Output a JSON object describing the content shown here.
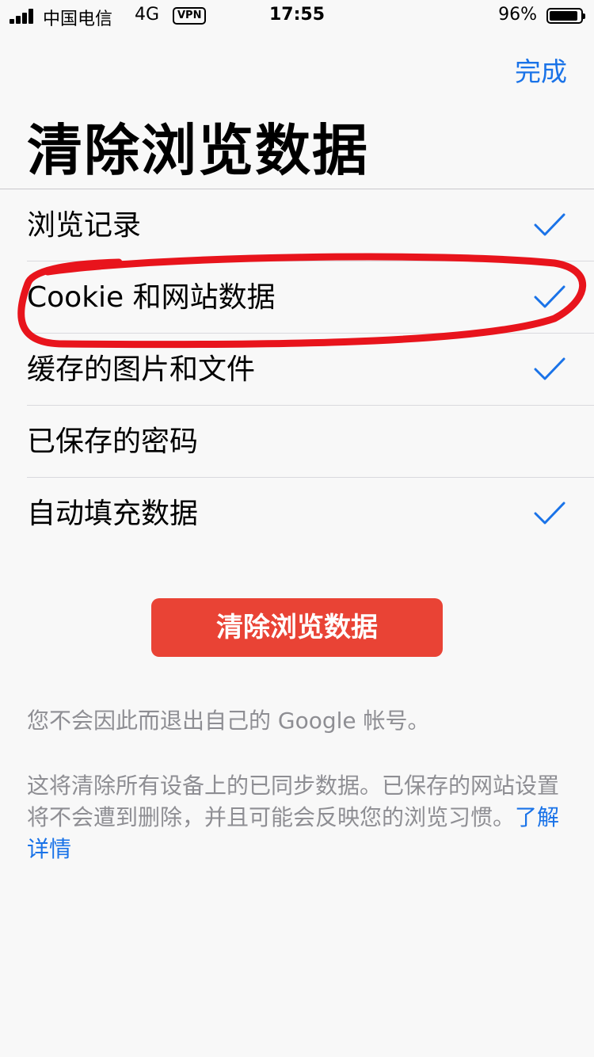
{
  "status_bar": {
    "carrier": "中国电信",
    "network": "4G",
    "vpn": "VPN",
    "time": "17:55",
    "battery": "96%"
  },
  "header": {
    "done_label": "完成",
    "title": "清除浏览数据"
  },
  "options": [
    {
      "label": "浏览记录",
      "checked": true
    },
    {
      "label": "Cookie 和网站数据",
      "checked": true
    },
    {
      "label": "缓存的图片和文件",
      "checked": true
    },
    {
      "label": "已保存的密码",
      "checked": false
    },
    {
      "label": "自动填充数据",
      "checked": true
    }
  ],
  "clear_button_label": "清除浏览数据",
  "notes": {
    "account": "您不会因此而退出自己的 Google 帐号。",
    "sync": "这将清除所有设备上的已同步数据。已保存的网站设置将不会遭到删除，并且可能会反映您的浏览习惯。",
    "learn_more": "了解详情"
  },
  "colors": {
    "accent": "#1a73e8",
    "button": "#e94335",
    "annotation": "#e8141c"
  }
}
